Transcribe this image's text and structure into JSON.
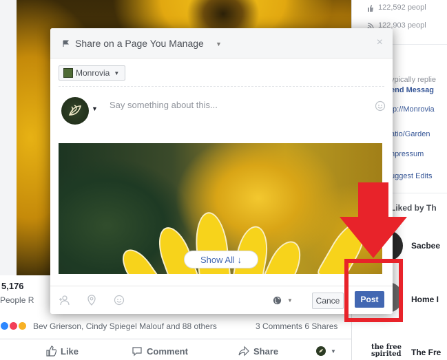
{
  "modal": {
    "title": "Share on a Page You Manage",
    "close_label": "×",
    "page_selector": "Monrovia",
    "composer_placeholder": "Say something about this...",
    "show_all_label": "Show All ↓",
    "cancel_label": "Cance",
    "post_label": "Post"
  },
  "post": {
    "count": "5,176",
    "count_sub": "People R",
    "reaction_names": "Bev Grierson, Cindy Spiegel Malouf and 88 others",
    "reaction_stats": "3 Comments  6 Shares",
    "actions": {
      "like": "Like",
      "comment": "Comment",
      "share": "Share"
    }
  },
  "sidebar": {
    "stat1": "122,592 peopl",
    "stat2": "122,903 peopl",
    "typically": "ypically replie",
    "send_message": "end Messag",
    "url": "tp://Monrovia",
    "category": "atio/Garden",
    "impressum": "npressum",
    "suggest": "uggest Edits",
    "liked_by": "Liked by Th",
    "item1": "Sacbee",
    "item2": "Home I",
    "item3": "The Fre",
    "item3_logo_top": "the free",
    "item3_logo_bottom": "spirited"
  },
  "colors": {
    "accent": "#4267b2",
    "annotation": "#e8232a"
  }
}
